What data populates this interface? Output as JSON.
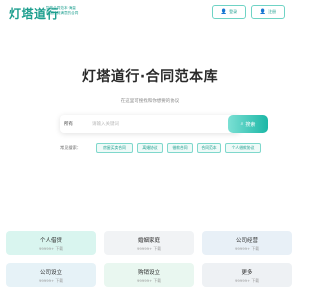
{
  "header": {
    "logo": "灯塔道行",
    "tagline_line1": "智能合同范本·海量",
    "tagline_line2": "助您找到满意的合同",
    "login_label": "登录",
    "register_label": "注册"
  },
  "hero": {
    "title": "灯塔道行·合同范本库",
    "subtitle": "在这里可搜找和你想要的协议"
  },
  "search": {
    "category": "所有",
    "placeholder": "请输入关键词",
    "button_label": "搜索"
  },
  "common": {
    "label": "常见搜索：",
    "tags": [
      "房屋买卖合同",
      "离婚协议",
      "借款合同",
      "合同范本",
      "个人借款协议"
    ]
  },
  "categories": [
    {
      "title": "个人借贷",
      "count": "99999+ 下载",
      "bg": "#d9f5ef"
    },
    {
      "title": "婚姻家庭",
      "count": "99999+ 下载",
      "bg": "#f1f3f5"
    },
    {
      "title": "公司经营",
      "count": "99999+ 下载",
      "bg": "#e8f0f7"
    },
    {
      "title": "公司设立",
      "count": "99999+ 下载",
      "bg": "#e6f2f7"
    },
    {
      "title": "购销设立",
      "count": "99999+ 下载",
      "bg": "#e9f7f0"
    },
    {
      "title": "更多",
      "count": "99999+ 下载",
      "bg": "#eef1f4"
    }
  ],
  "colors": {
    "brand": "#1c9e8e",
    "button_gradient_start": "#7be0d4",
    "button_gradient_end": "#1cb7a6"
  }
}
